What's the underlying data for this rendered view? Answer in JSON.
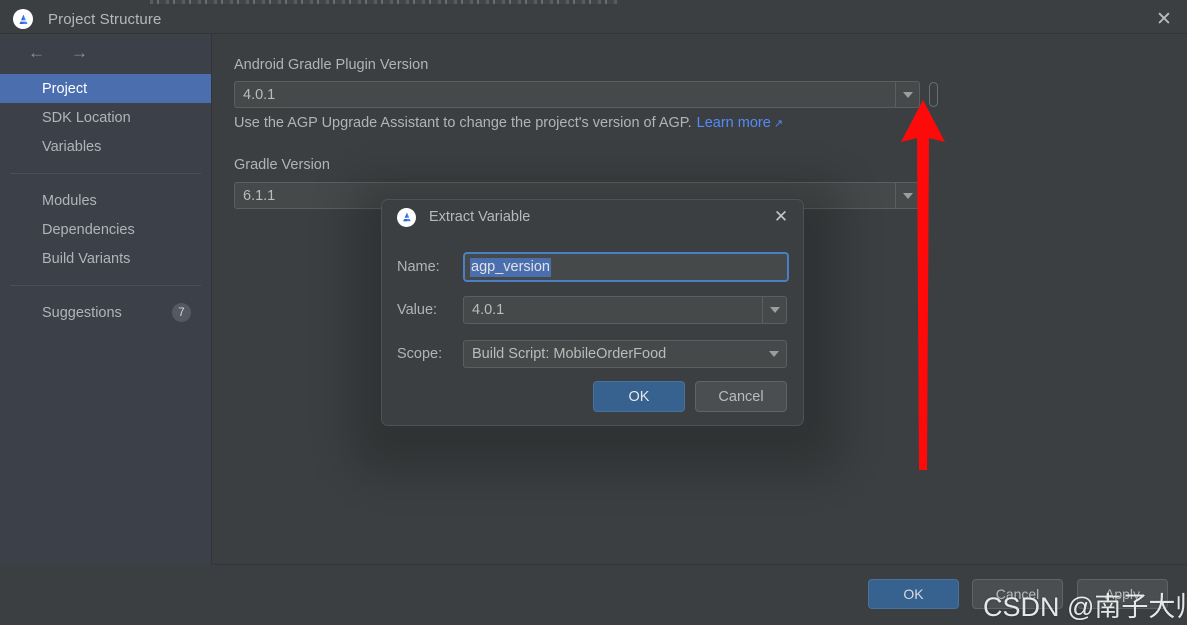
{
  "window": {
    "title": "Project Structure",
    "app_icon": "android-studio-icon",
    "close_icon": "close-icon"
  },
  "sidebar": {
    "nav": {
      "back_icon": "arrow-left-icon",
      "forward_icon": "arrow-right-icon"
    },
    "items": [
      {
        "label": "Project",
        "selected": true
      },
      {
        "label": "SDK Location",
        "selected": false
      },
      {
        "label": "Variables",
        "selected": false
      },
      {
        "label": "Modules",
        "selected": false
      },
      {
        "label": "Dependencies",
        "selected": false
      },
      {
        "label": "Build Variants",
        "selected": false
      },
      {
        "label": "Suggestions",
        "selected": false,
        "badge": "7"
      }
    ],
    "suggestions_badge": "7"
  },
  "main": {
    "agp": {
      "label": "Android Gradle Plugin Version",
      "value": "4.0.1",
      "hint_text": "Use the AGP Upgrade Assistant to change the project's version of AGP.",
      "hint_link": "Learn more",
      "hint_link_icon": "external-link-icon",
      "variable_button": "extract-variable-button"
    },
    "gradle": {
      "label": "Gradle Version",
      "value": "6.1.1"
    }
  },
  "dialog": {
    "title": "Extract Variable",
    "icon": "android-studio-icon",
    "close_icon": "close-icon",
    "fields": {
      "name_label": "Name:",
      "name_value": "agp_version",
      "value_label": "Value:",
      "value_value": "4.0.1",
      "scope_label": "Scope:",
      "scope_value": "Build Script: MobileOrderFood"
    },
    "buttons": {
      "ok": "OK",
      "cancel": "Cancel"
    }
  },
  "footer": {
    "ok": "OK",
    "cancel": "Cancel",
    "apply": "Apply"
  },
  "annotation": {
    "arrow": "red-up-arrow",
    "arrow_color": "#FF0A0A",
    "watermark": "CSDN @南子大帅哥"
  },
  "colors": {
    "window_bg": "#3c3f41",
    "sidebar_bg": "#3c4149",
    "selection_blue": "#4b6eaf",
    "link_blue": "#548af7",
    "primary_button": "#37618e",
    "field_bg": "#45494a",
    "text": "#b0b4b8"
  }
}
